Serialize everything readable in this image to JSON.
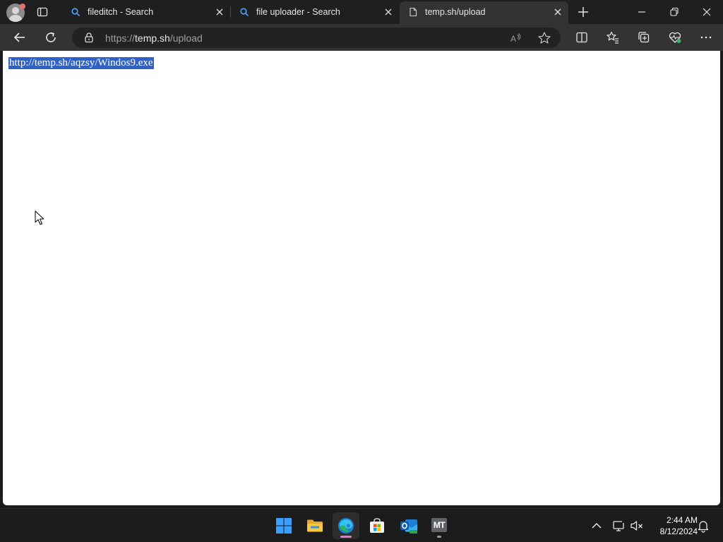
{
  "tabs": [
    {
      "label": "fileditch - Search",
      "icon": "search-icon",
      "active": false
    },
    {
      "label": "file uploader - Search",
      "icon": "search-icon",
      "active": false
    },
    {
      "label": "temp.sh/upload",
      "icon": "page-icon",
      "active": true
    }
  ],
  "address": {
    "scheme": "https://",
    "host": "temp.sh",
    "path": "/upload"
  },
  "page": {
    "link_text": "http://temp.sh/aqzsy/Windos9.exe",
    "selection_color": "#2e62c9"
  },
  "taskbar": {
    "apps": [
      "start-icon",
      "file-explorer-icon",
      "edge-icon",
      "store-icon",
      "outlook-icon",
      "mt-app-icon"
    ],
    "mt_label": "MT",
    "time": "2:44 AM",
    "date": "8/12/2024"
  },
  "colors": {
    "chrome_bg": "#1f1f1f",
    "toolbar_bg": "#333333",
    "accent": "#2e62c9"
  }
}
